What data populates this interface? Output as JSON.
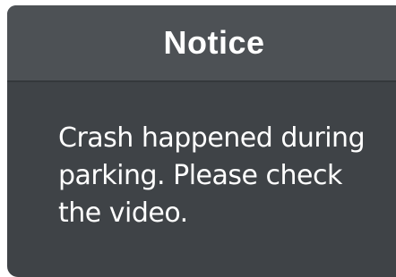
{
  "dialog": {
    "title": "Notice",
    "message": "Crash happened during parking. Please check the video."
  },
  "colors": {
    "header_background": "#4d5155",
    "body_background": "#3f4347",
    "text": "#ffffff"
  }
}
